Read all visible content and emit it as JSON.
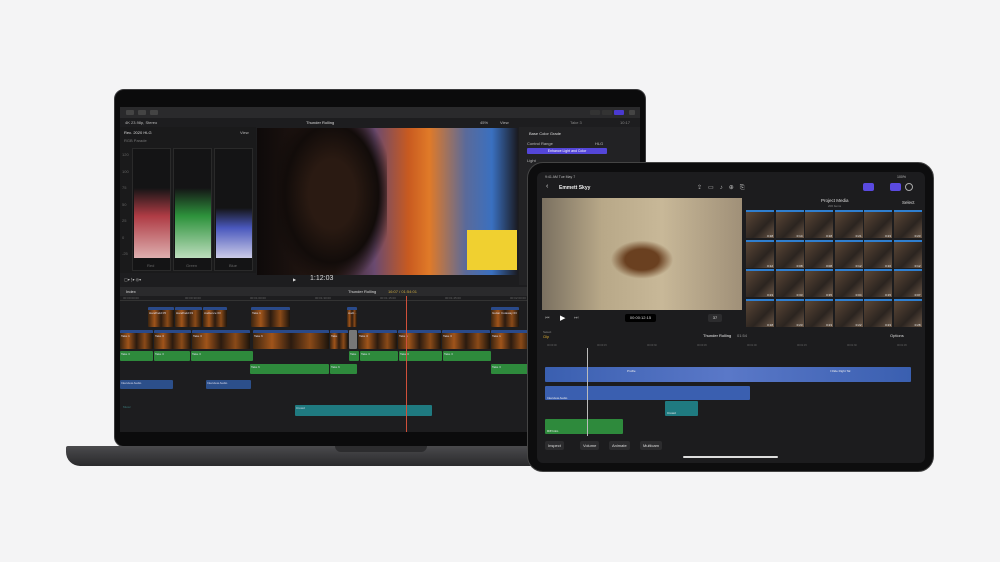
{
  "mac": {
    "toolbar": {
      "format": "4K 23.98p, Stereo",
      "project_title": "Thunder Rolling",
      "zoom": "45%",
      "view_label": "View",
      "clip_name": "Take 3",
      "duration": "10:17"
    },
    "scopes": {
      "color_space": "Rec. 2020 HLG",
      "view_label": "View",
      "scope_type": "RGB Parade",
      "scale": [
        "120",
        "100",
        "75",
        "50",
        "25",
        "0",
        "-25"
      ],
      "channels": [
        "Red",
        "Green",
        "Blue"
      ]
    },
    "viewer": {
      "timecode": "1:12:03"
    },
    "inspector": {
      "effect": "Base Color Grade",
      "control_range_label": "Control Range",
      "control_range_value": "HLG",
      "enhance_button": "Enhance Light and Color",
      "light_label": "Light"
    },
    "timeline": {
      "index_label": "Index",
      "project": "Thunder Rolling",
      "position": "16:07 / 01:54:01",
      "ruler": [
        "00:00:00:00",
        "00:00:30:00",
        "00:01:00:00",
        "00:01:30:00",
        "00:01:15:00",
        "00:01:45:00",
        "00:02:00:00"
      ],
      "connected_clips": [
        "Handheld 05",
        "Handheld 03",
        "Audience 03",
        "Take 1",
        "Audi...",
        "Guitar Cutaway 03"
      ],
      "primary_clips": [
        "Take 1",
        "Take 3",
        "Take 3",
        "Take 6",
        "Take",
        "Take 3",
        "Take 1",
        "Take 3",
        "Take 1"
      ],
      "audio_clips": [
        "Take 3",
        "Take 3",
        "Take 3",
        "Take",
        "Take 3",
        "Take 3",
        "Take 3",
        "Take 6",
        "Take 6",
        "Take 3"
      ],
      "interview_clips": [
        "Interview Audio",
        "Interview Audio"
      ],
      "music_lane": "Music",
      "music_clip": "Crowd"
    }
  },
  "ipad": {
    "status": {
      "time": "9:41 AM  Tue May 7",
      "battery": "100%"
    },
    "nav": {
      "title": "Emmett Skyy"
    },
    "viewer": {
      "timecode": "00:00:12:15",
      "frame": "37"
    },
    "browser": {
      "title": "Project Media",
      "count": "206 Items",
      "select": "Select",
      "durations": [
        "0:18",
        "0:14",
        "0:18",
        "0:21",
        "0:23",
        "0:23",
        "0:12",
        "0:08",
        "0:08",
        "0:12",
        "0:16",
        "0:12",
        "0:23",
        "0:33",
        "0:35",
        "0:04",
        "0:15",
        "0:07",
        "0:18",
        "0:23",
        "0:23",
        "0:22",
        "0:23",
        "0:28"
      ]
    },
    "timeline": {
      "select_label": "Select",
      "clip_label": "Clip",
      "project": "Thunder Rolling",
      "duration": "01:54",
      "options": "Options",
      "ruler": [
        "00:00:00",
        "00:00:15",
        "00:00:30",
        "00:00:45",
        "00:01:00",
        "00:01:15",
        "00:01:30",
        "00:01:45"
      ],
      "clips": {
        "profile": "Profile",
        "title": "I Ride Right Tal",
        "interview": "Interview Audio",
        "crowd": "Crowd",
        "music": "Riff Intro"
      }
    },
    "toolbar": {
      "inspect": "Inspect",
      "volume": "Volume",
      "animate": "Animate",
      "multicam": "Multicam"
    }
  }
}
